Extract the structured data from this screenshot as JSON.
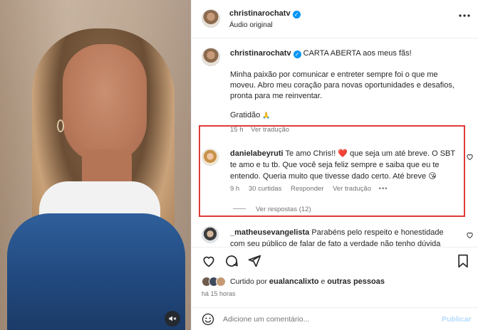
{
  "video": {
    "mute_icon": "speaker-muted-icon"
  },
  "header": {
    "username": "christinarochatv",
    "subtitle": "Áudio original",
    "more_icon": "more-horizontal-icon"
  },
  "caption": {
    "username": "christinarochatv",
    "headline": "CARTA ABERTA aos meus fãs!",
    "paragraph": "Minha paixão por comunicar e entreter sempre foi o que me moveu. Abro meu coração para novas oportunidades e desafios, pronta para me reinventar.",
    "closing": "Gratidão",
    "time": "15 h",
    "translate": "Ver tradução"
  },
  "comments": [
    {
      "username": "danielabeyruti",
      "text": "Te amo Chris!! ❤️ que seja um até breve. O SBT te amo e tu tb. Que você seja feliz sempre e saiba que eu te entendo. Queria muito que tivesse dado certo. Até breve 😘",
      "time": "9 h",
      "likes": "30 curtidas",
      "reply": "Responder",
      "translate": "Ver tradução",
      "more": "•••",
      "replies": "Ver respostas (12)"
    },
    {
      "username": "_matheusevangelista",
      "text": "Parabéns pelo respeito e honestidade com seu público de falar de fato a verdade não tenho dúvida"
    }
  ],
  "likes": {
    "prefix": "Curtido por",
    "user": "eualancalixto",
    "connector": "e",
    "others": "outras pessoas",
    "time": "há 15 horas"
  },
  "comment_box": {
    "placeholder": "Adicione um comentário...",
    "publish": "Publicar"
  },
  "colors": {
    "accent": "#0095f6",
    "highlight_border": "#e03a3a",
    "text": "#262626",
    "muted": "#737373"
  }
}
